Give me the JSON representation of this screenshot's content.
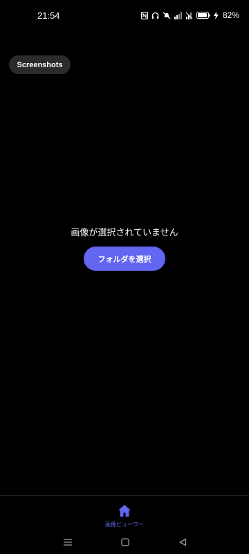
{
  "status_bar": {
    "time": "21:54",
    "battery_percent": "82%",
    "icons": [
      "nfc-icon",
      "headphones-icon",
      "mute-icon",
      "signal-icon",
      "battery-icon",
      "charging-icon"
    ]
  },
  "filter_chip": {
    "label": "Screenshots"
  },
  "main": {
    "empty_message": "画像が選択されていません",
    "select_folder_label": "フォルダを選択"
  },
  "bottom_nav": {
    "items": [
      {
        "label": "画像ビューワー",
        "icon": "home-icon",
        "active": true
      }
    ]
  },
  "system_nav": {
    "icons": [
      "menu-icon",
      "home-square-icon",
      "back-triangle-icon"
    ]
  },
  "colors": {
    "accent": "#6366f1",
    "background": "#000000",
    "chip_bg": "#2b2b2b"
  }
}
